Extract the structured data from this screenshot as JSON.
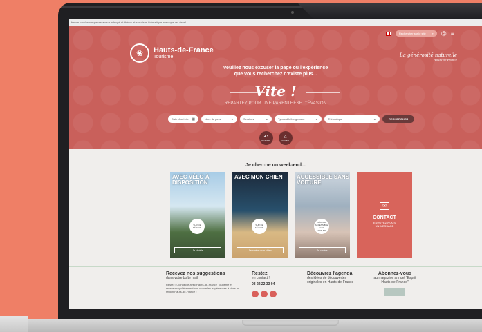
{
  "browser": {
    "url": "france.com/remarque-ee-amsur-adsupé-et-thème-et-surprises-thématique-avec-que-ret-detail"
  },
  "header": {
    "search_placeholder": "Rechercher sur le site",
    "brand_name": "Hauts-de-France",
    "brand_sub": "Tourisme",
    "slogan": "La générosité naturelle",
    "slogan_sub": "Hauts-de-France"
  },
  "hero": {
    "message_line1": "Veuillez nous excuser la page ou l'expérience",
    "message_line2": "que vous recherchez n'existe plus...",
    "vite": "Vite !",
    "tagline": "REPARTEZ POUR UNE PARENTHÈSE D'ÉVASION",
    "filters": [
      "Date d'arrivée",
      "Nbre de pers.",
      "Services",
      "Types d'hébergement",
      "Thématique"
    ],
    "search_button": "RECHERCHER",
    "back_label": "RETOUR",
    "home_label": "ACCUEIL",
    "back_icon": "back-arrow-icon",
    "home_icon": "home-icon"
  },
  "week": {
    "heading": "Je cherche un week-end...",
    "cards": [
      {
        "title": "AVEC VÉLO À DISPOSITION",
        "badge": "SUR CE SÉJOUR",
        "button": "Je choisis"
      },
      {
        "title": "AVEC MON CHIEN",
        "badge": "SUR CE SÉJOUR",
        "button": "J'emmène mon chien"
      },
      {
        "title": "ACCESSIBLE SANS VOITURE",
        "badge": "SÉJOUR ACCESSIBLE SANS VOITURE",
        "button": "Je choisis"
      }
    ],
    "contact": {
      "title": "CONTACT",
      "sub1": "ENVOYEZ-NOUS",
      "sub2": "UN MESSAGE"
    }
  },
  "footer": {
    "col1_title": "Recevez nos suggestions",
    "col1_sub": "dans votre boîte mail",
    "col1_text": "Restez e-connecté avec Hauts-de-France Tourisme et recevez régulièrement nos nouvelles expériences à vivre en région Hauts-de-France !",
    "col2_title": "Restez",
    "col2_sub": "en contact !",
    "phone": "03 22 22 33 94",
    "col3_title": "Découvrez l'agenda",
    "col3_sub": "des idées de découvertes originales en Hauts-de-France",
    "col4_title": "Abonnez-vous",
    "col4_sub": "au magazine annuel \"Esprit Hauts-de-France\""
  }
}
